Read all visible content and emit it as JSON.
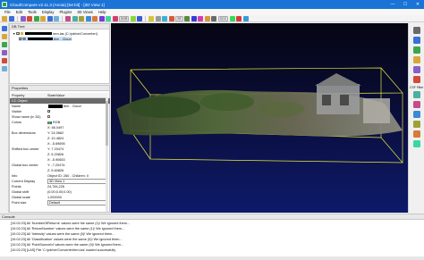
{
  "window": {
    "title": "CloudCompare v2.11.3 (Anoia) [64-bit] - [3D View 1]",
    "minimize": "—",
    "maximize": "☐",
    "close": "✕"
  },
  "menu": [
    "File",
    "Edit",
    "Tools",
    "Display",
    "Plugins",
    "3D Views",
    "Help"
  ],
  "toolbar": {
    "sor_label": "SOR",
    "sf_label": "SF",
    "ccc_label": "CCC"
  },
  "db_tree": {
    "title": "DB Tree",
    "items": [
      {
        "suffix": "tem.las (C:/pdrive/Converter/)",
        "checked": true
      },
      {
        "suffix": "tem - Cloud",
        "checked": true
      }
    ]
  },
  "properties": {
    "title": "Properties",
    "header_key": "Property",
    "header_value": "State/Value",
    "section": "CC Object",
    "rows": [
      {
        "k": "Name",
        "v": "tem - Cloud"
      },
      {
        "k": "Visible",
        "v": ""
      },
      {
        "k": "Show name (in 3D)",
        "v": ""
      },
      {
        "k": "Colors",
        "v": "RGB"
      },
      {
        "k": "",
        "v": "X: 66.0497"
      },
      {
        "k": "Box dimensions",
        "v": "Y: 24.0662"
      },
      {
        "k": "",
        "v": "Z: 10.4824"
      },
      {
        "k": "",
        "v": "X: -5.69695"
      },
      {
        "k": "Shifted box center",
        "v": "Y: 7.20474"
      },
      {
        "k": "",
        "v": "Z: 5.20826"
      },
      {
        "k": "",
        "v": "X: -5.90653"
      },
      {
        "k": "Global box center",
        "v": "Y: -7.20474"
      },
      {
        "k": "",
        "v": "Z: 5.60826"
      },
      {
        "k": "Info",
        "v": "Object ID: 260 - Children: 0"
      },
      {
        "k": "Current Display",
        "v": "3D View 1"
      },
      {
        "k": "Points",
        "v": "24,784,226"
      },
      {
        "k": "Global shift",
        "v": "(0.00;0.00;0.00)"
      },
      {
        "k": "Global scale",
        "v": "1.000000"
      },
      {
        "k": "Point size",
        "v": "Default"
      }
    ]
  },
  "viewer": {
    "label": "3D View 1"
  },
  "right_toolbar": {
    "filter_label": "CSF Filter"
  },
  "console": {
    "title": "Console",
    "lines": [
      "[10:02:23] All 'NumberOfReturns' values were the same (1)! We ignored them...",
      "[10:02:23] All 'ReturnNumber' values were the same (1)! We ignored them...",
      "[10:02:23] All 'Intensity' values were the same (0)! We ignored them...",
      "[10:02:23] All 'Classification' values were the same (0)! We ignored them...",
      "[10:02:23] All 'PointSourceId' values were the same (0)! We ignored them...",
      "[10:02:23] [LAS] File 'C:/pdrive/Converter/tem.las' loaded successfully"
    ]
  }
}
